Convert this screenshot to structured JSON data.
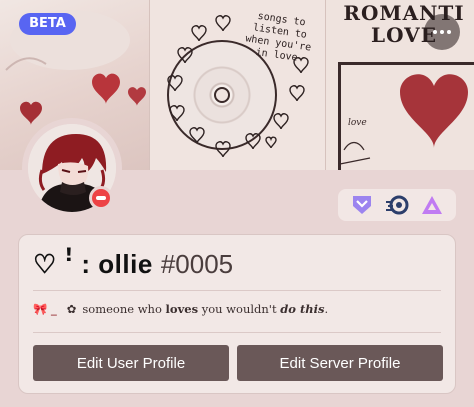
{
  "banner": {
    "beta_label": "BETA",
    "cd_lines": [
      "songs to",
      "listen to",
      "when you're",
      "in love"
    ],
    "romantic_line1": "ROMANTI",
    "romantic_line2": "LOVE",
    "script_word": "love",
    "more_icon": "more-dots-icon"
  },
  "avatar": {
    "status": "do-not-disturb",
    "status_color": "#ed4245"
  },
  "badges": [
    {
      "name": "hypesquad-bravery-badge",
      "color": "#9c84ef"
    },
    {
      "name": "nitro-boost-badge",
      "color": "#2c3e6b"
    },
    {
      "name": "nitro-triangle-badge",
      "color": "#c07bf2"
    }
  ],
  "profile": {
    "display_name": "♡ ꜝ : ollie",
    "discriminator": "#0005",
    "bio_prefix": "🎀 _",
    "bio_flower": "✿",
    "bio_part1": "someone who ",
    "bio_bold1": "loves",
    "bio_part2": " you wouldn't ",
    "bio_bold2": "do this",
    "bio_end": "."
  },
  "actions": {
    "edit_user_profile": "Edit User Profile",
    "edit_server_profile": "Edit Server Profile"
  },
  "colors": {
    "accent": "#5865f2",
    "button_bg": "#6a5858",
    "card_bg": "#f2e8e6",
    "page_bg": "#e8d5d4"
  }
}
